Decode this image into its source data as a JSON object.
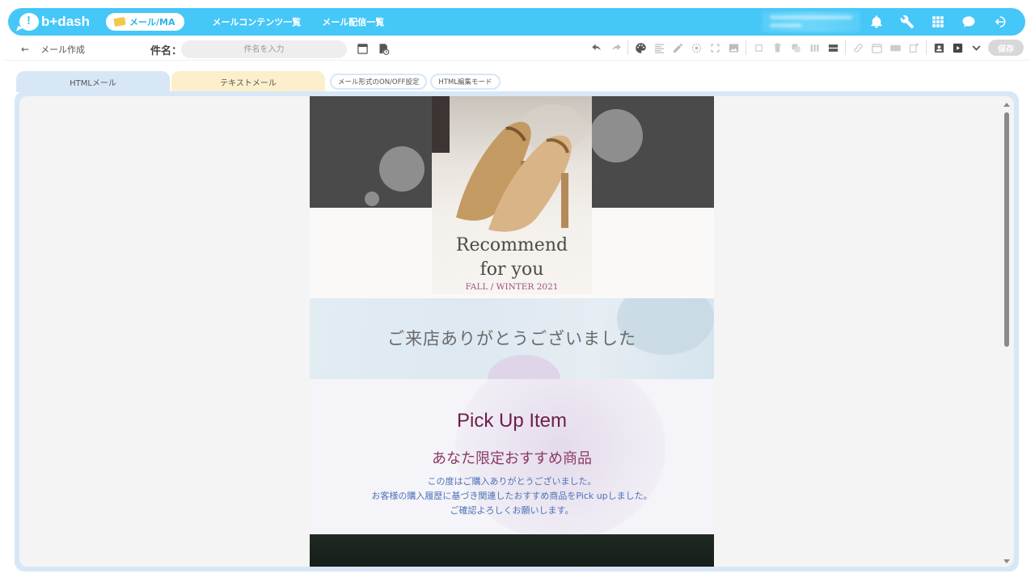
{
  "app": {
    "logo_text": "b+dash",
    "module_pill": "メール/MA",
    "nav": [
      "メールコンテンツ一覧",
      "メール配信一覧"
    ]
  },
  "toolbar": {
    "back_label": "メール作成",
    "subject_label": "件名：",
    "subject_placeholder": "件名を入力",
    "save_label": "保存"
  },
  "tabs": {
    "html_mail": "HTMLメール",
    "text_mail": "テキストメール",
    "format_toggle": "メール形式のON/OFF設定",
    "html_edit_mode": "HTML編集モード"
  },
  "email": {
    "hero_title_line1": "Recommend",
    "hero_title_line2": "for you",
    "hero_subtitle": "FALL / WINTER 2021",
    "thanks": "ご来店ありがとうございました",
    "pickup_title": "Pick Up Item",
    "pickup_subtitle": "あなた限定おすすめ商品",
    "pickup_desc": [
      "この度はご購入ありがとうございました。",
      "お客様の購入履歴に基づき関連したおすすめ商品をPick upしました。",
      "ご確認よろしくお願いします。"
    ]
  },
  "colors": {
    "brand": "#45c7f7",
    "tab_html": "#d7e7f6",
    "tab_text": "#fbefcc",
    "pickup_title": "#6c1f4a",
    "pickup_desc": "#4c72b8"
  }
}
